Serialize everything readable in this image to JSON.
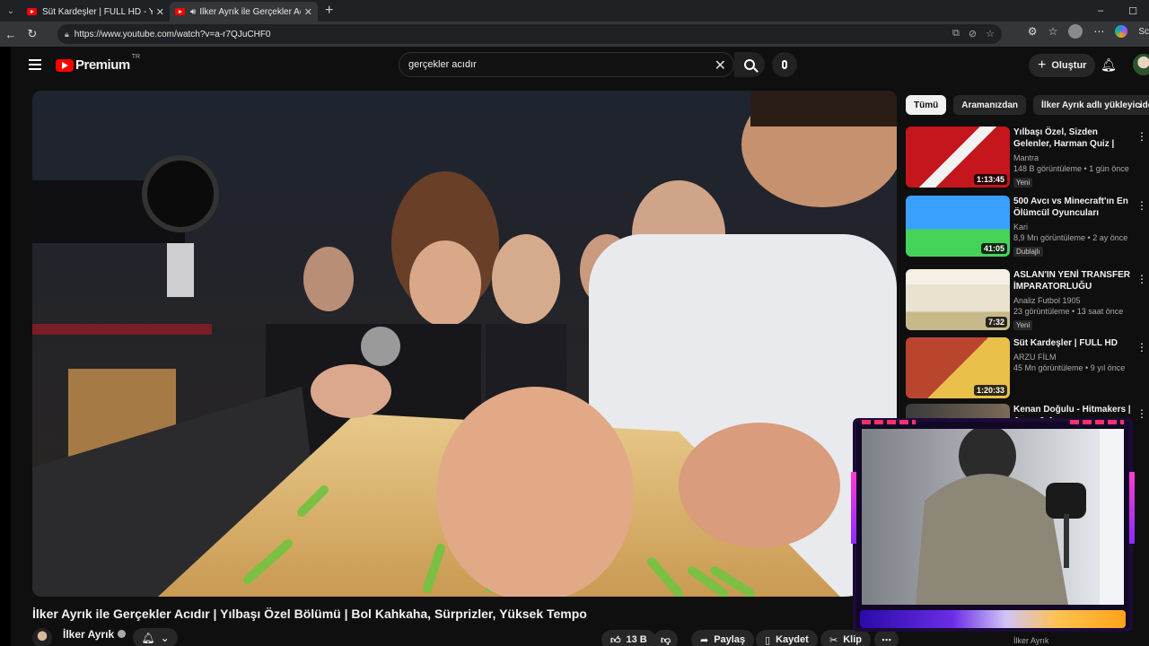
{
  "browser": {
    "tabs": [
      {
        "title": "Süt Kardeşler | FULL HD - YouTube",
        "active": false
      },
      {
        "title": "İlker Ayrık ile Gerçekler Acıdır",
        "active": true
      }
    ],
    "url": "https://www.youtube.com/watch?v=a-r7QJuCHF0",
    "sidebar_label": "Sc"
  },
  "youtube": {
    "logo_text": "Premium",
    "logo_country": "TR",
    "search_query": "gerçekler acıdır",
    "create_label": "Oluştur"
  },
  "video": {
    "title": "İlker Ayrık ile Gerçekler Acıdır | Yılbaşı Özel Bölümü | Bol Kahkaha, Sürprizler, Yüksek Tempo",
    "channel": "İlker Ayrık",
    "likes": "13 B",
    "share_label": "Paylaş",
    "save_label": "Kaydet",
    "clip_label": "Klip"
  },
  "chips": [
    "Tümü",
    "Aramanızdan",
    "İlker Ayrık adlı yükleyiciden"
  ],
  "recommendations": [
    {
      "title": "Yılbaşı Özel, Sizden Gelenler, Harman Quiz | Erman Yaşar & ...",
      "channel": "Mantra",
      "meta": "148 B görüntüleme • 1 gün önce",
      "badge": "Yeni",
      "duration": "1:13:45",
      "thumb_colors": [
        "#c4161c",
        "#f2f2f2"
      ]
    },
    {
      "title": "500 Avcı vs Minecraft'ın En Ölümcül Oyuncuları",
      "channel": "Kari",
      "meta": "8,9 Mn görüntüleme • 2 ay önce",
      "badge": "Dublajlı",
      "duration": "41:05",
      "thumb_colors": [
        "#3aa0ff",
        "#45d35a"
      ]
    },
    {
      "title": "ASLAN'IN YENİ TRANSFER İMPARATORLUĞU YILDIZLARI",
      "channel": "Analiz Futbol 1905",
      "meta": "23 görüntüleme • 13 saat önce",
      "badge": "Yeni",
      "duration": "7:32",
      "thumb_colors": [
        "#f4f0e6",
        "#c8b98a"
      ]
    },
    {
      "title": "Süt Kardeşler | FULL HD",
      "channel": "ARZU FİLM",
      "meta": "45 Mn görüntüleme • 9 yıl önce",
      "badge": "",
      "duration": "1:20:33",
      "thumb_colors": [
        "#b9452f",
        "#e8c04a"
      ]
    },
    {
      "title": "Kenan Doğulu - Hitmakers | Arem & Arman",
      "channel": "",
      "meta": "",
      "badge": "",
      "duration": "",
      "thumb_colors": [
        "#3a3a3a",
        "#7a6a5a"
      ]
    }
  ],
  "partial_bottom": {
    "channel": "İlker Ayrık"
  }
}
